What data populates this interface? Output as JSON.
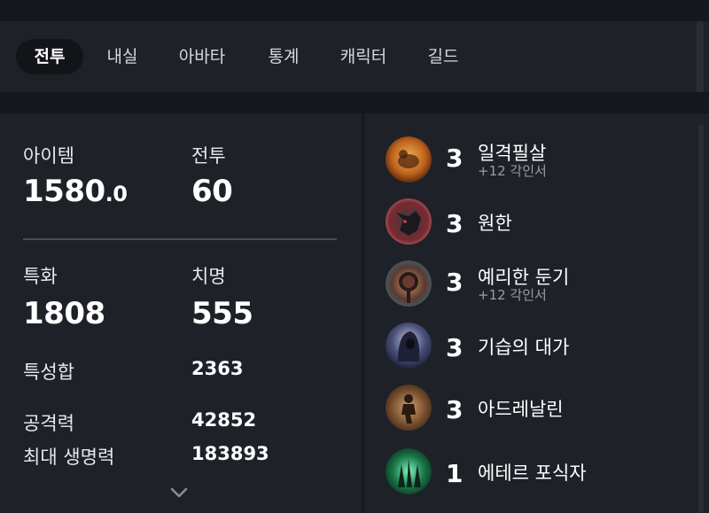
{
  "tabs": [
    {
      "label": "전투",
      "active": true
    },
    {
      "label": "내실",
      "active": false
    },
    {
      "label": "아바타",
      "active": false
    },
    {
      "label": "통계",
      "active": false
    },
    {
      "label": "캐릭터",
      "active": false
    },
    {
      "label": "길드",
      "active": false
    }
  ],
  "stats": {
    "item_label": "아이템",
    "item_level_int": "1580",
    "item_level_dec": ".0",
    "battle_label": "전투",
    "battle_value": "60",
    "spec_label": "특화",
    "spec_value": "1808",
    "crit_label": "치명",
    "crit_value": "555",
    "trait_sum_label": "특성합",
    "trait_sum_value": "2363",
    "attack_label": "공격력",
    "attack_value": "42852",
    "max_hp_label": "최대 생명력",
    "max_hp_value": "183893"
  },
  "engravings": [
    {
      "level": "3",
      "name": "일격필살",
      "sub": "+12 각인서",
      "icon": "grudge-fist-icon",
      "color": "#d07a2a"
    },
    {
      "level": "3",
      "name": "원한",
      "sub": "",
      "icon": "wolf-beast-icon",
      "color": "#7a3a3a"
    },
    {
      "level": "3",
      "name": "예리한 둔기",
      "sub": "+12 각인서",
      "icon": "spiked-mace-icon",
      "color": "#6a4a3a"
    },
    {
      "level": "3",
      "name": "기습의 대가",
      "sub": "",
      "icon": "hooded-assassin-icon",
      "color": "#4a4f7a"
    },
    {
      "level": "3",
      "name": "아드레날린",
      "sub": "",
      "icon": "adrenaline-runner-icon",
      "color": "#8a6a4a"
    },
    {
      "level": "1",
      "name": "에테르 포식자",
      "sub": "",
      "icon": "ether-claw-icon",
      "color": "#2a8a5a"
    }
  ]
}
